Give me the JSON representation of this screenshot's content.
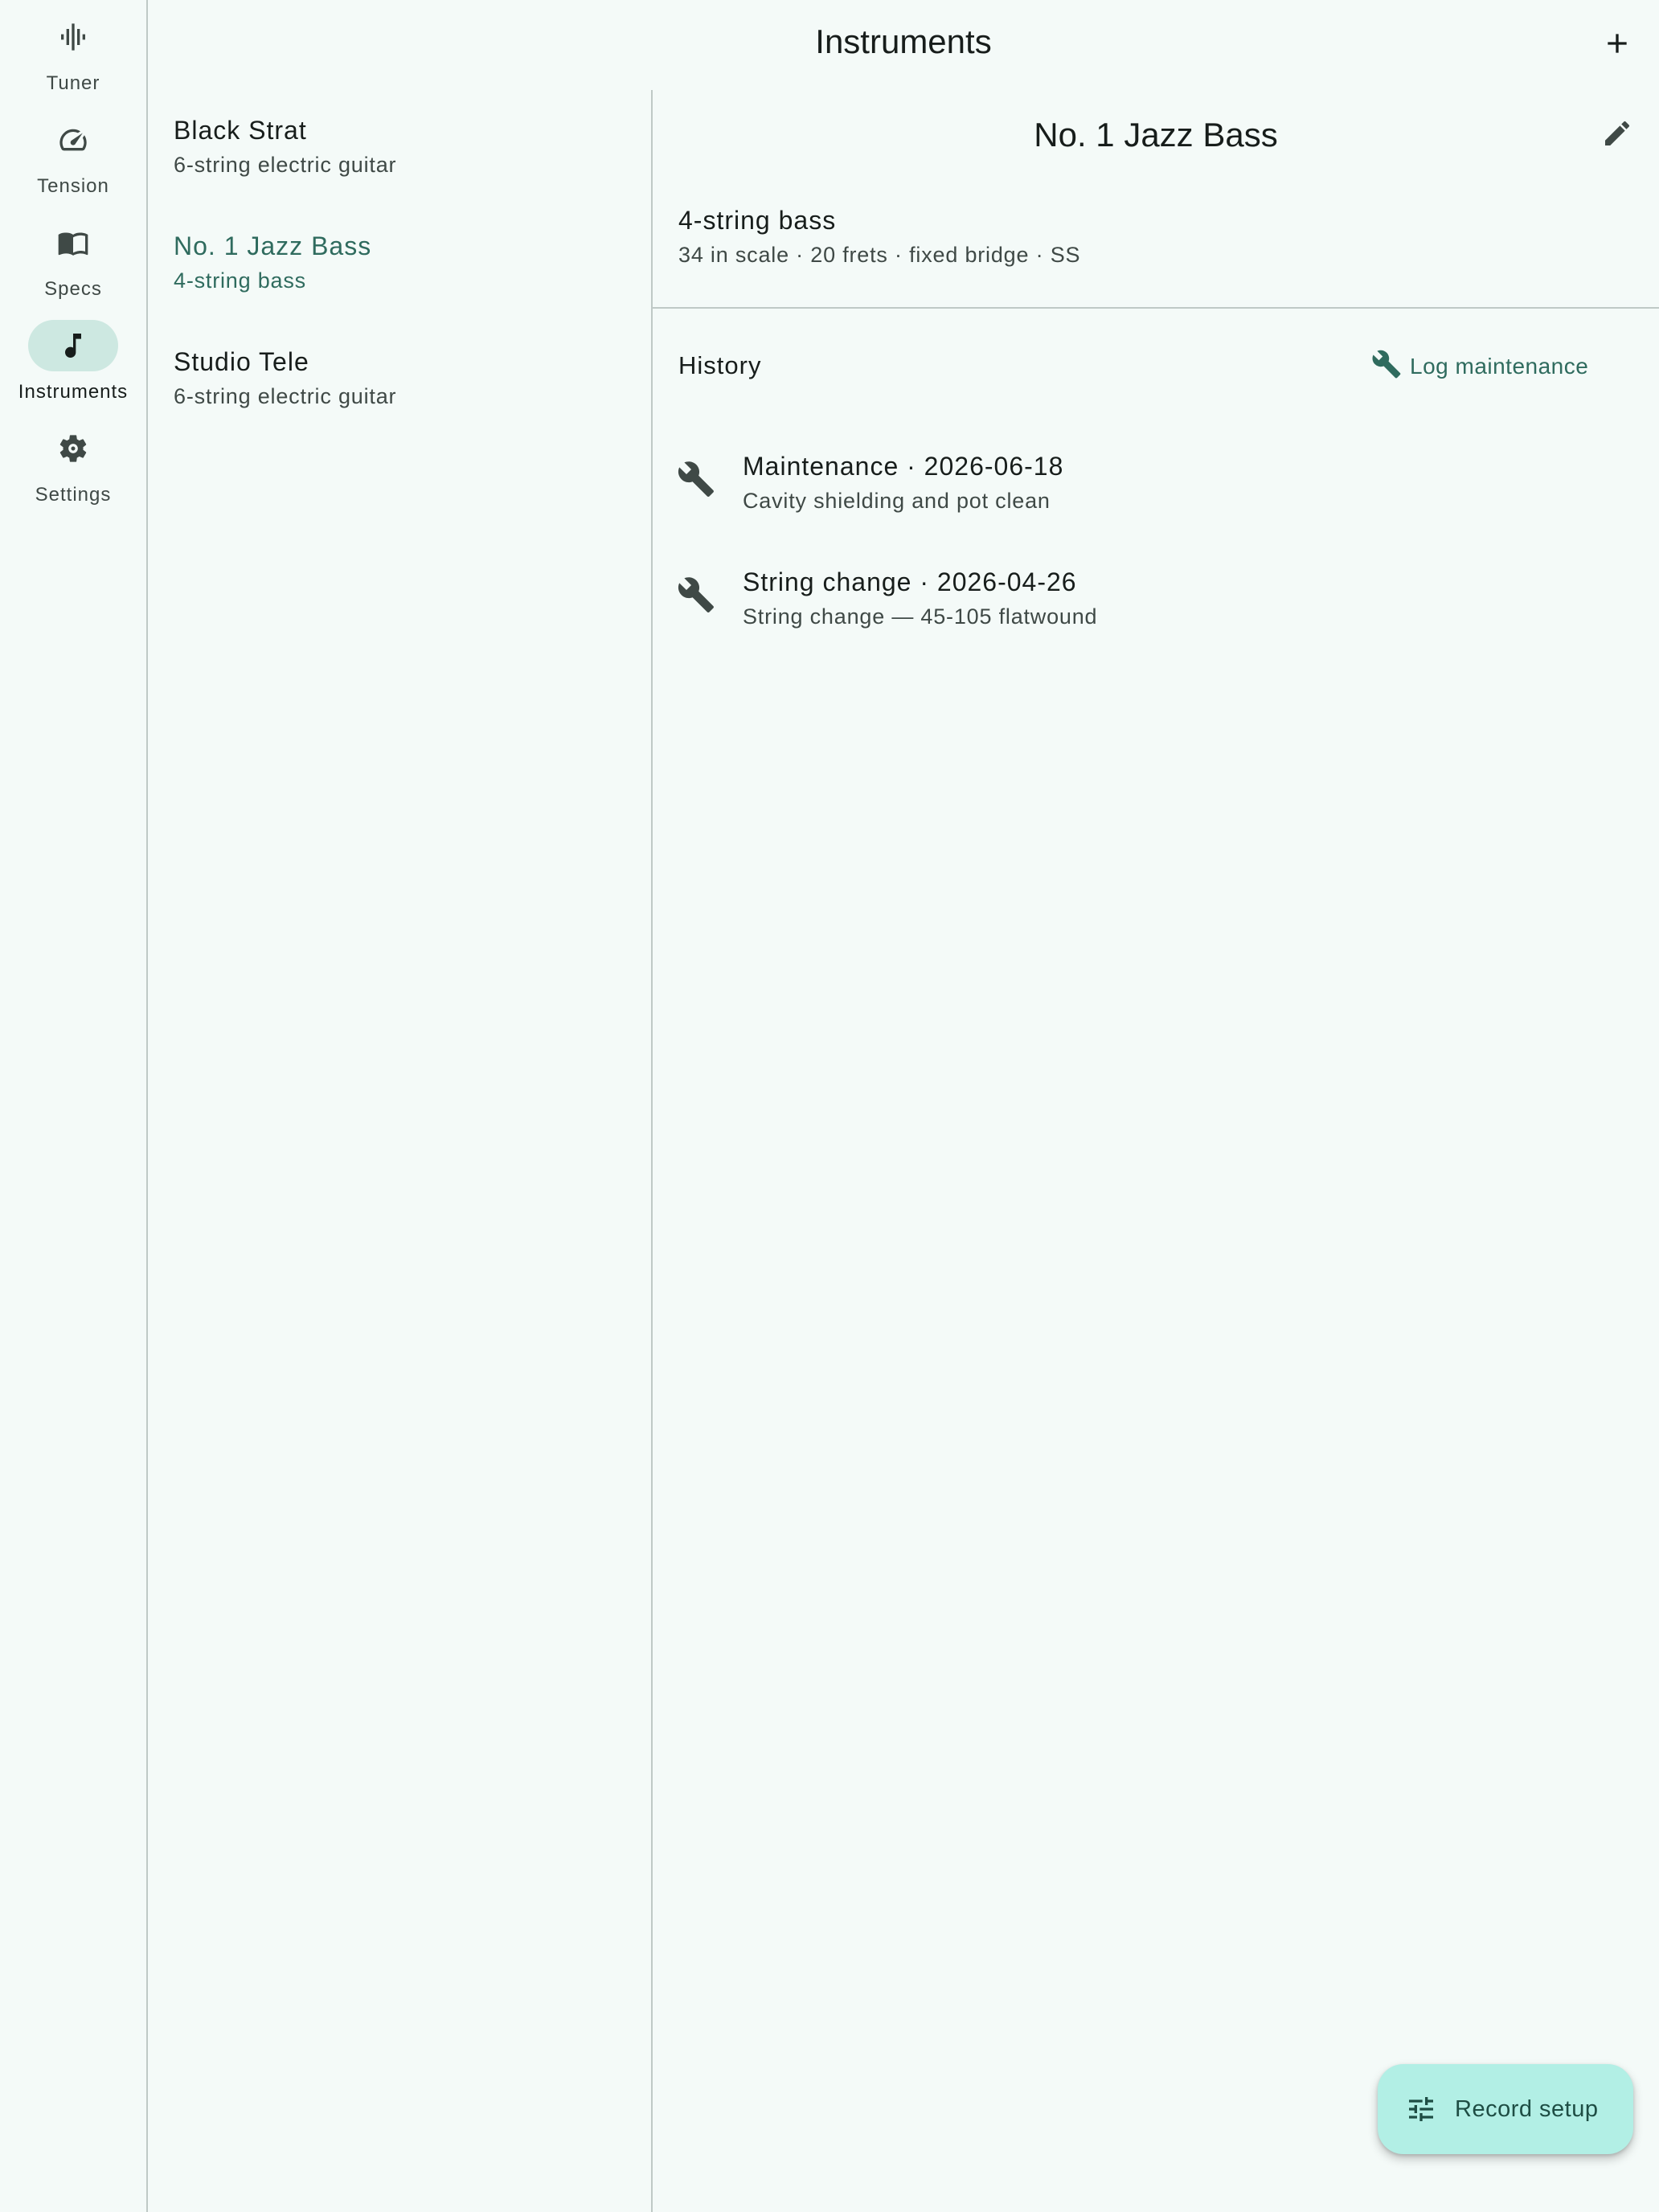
{
  "rail": {
    "items": [
      {
        "label": "Tuner",
        "icon": "tuner-waveform-icon",
        "active": false
      },
      {
        "label": "Tension",
        "icon": "speedometer-icon",
        "active": false
      },
      {
        "label": "Specs",
        "icon": "book-icon",
        "active": false
      },
      {
        "label": "Instruments",
        "icon": "music-note-icon",
        "active": true
      },
      {
        "label": "Settings",
        "icon": "gear-icon",
        "active": false
      }
    ]
  },
  "header": {
    "title": "Instruments",
    "add_icon": "plus-icon"
  },
  "instruments": [
    {
      "name": "Black Strat",
      "type": "6-string electric guitar",
      "selected": false
    },
    {
      "name": "No. 1 Jazz Bass",
      "type": "4-string bass",
      "selected": true
    },
    {
      "name": "Studio Tele",
      "type": "6-string electric guitar",
      "selected": false
    }
  ],
  "detail": {
    "title": "No. 1 Jazz Bass",
    "edit_icon": "pencil-icon",
    "summary_title": "4-string bass",
    "summary_sub": "34 in scale · 20 frets · fixed bridge · SS",
    "history_heading": "History",
    "log_button": "Log maintenance",
    "history": [
      {
        "title": "Maintenance · 2026-06-18",
        "description": "Cavity shielding and pot clean",
        "icon": "wrench-icon"
      },
      {
        "title": "String change · 2026-04-26",
        "description": "String change — 45-105 flatwound",
        "icon": "wrench-icon"
      }
    ]
  },
  "fab": {
    "label": "Record setup",
    "icon": "tune-sliders-icon"
  },
  "colors": {
    "background": "#f4faf8",
    "accent": "#2f6b5e",
    "rail_active_indicator": "#cde8e1",
    "fab_background": "#b2efe5",
    "divider": "#bfc9c6"
  }
}
